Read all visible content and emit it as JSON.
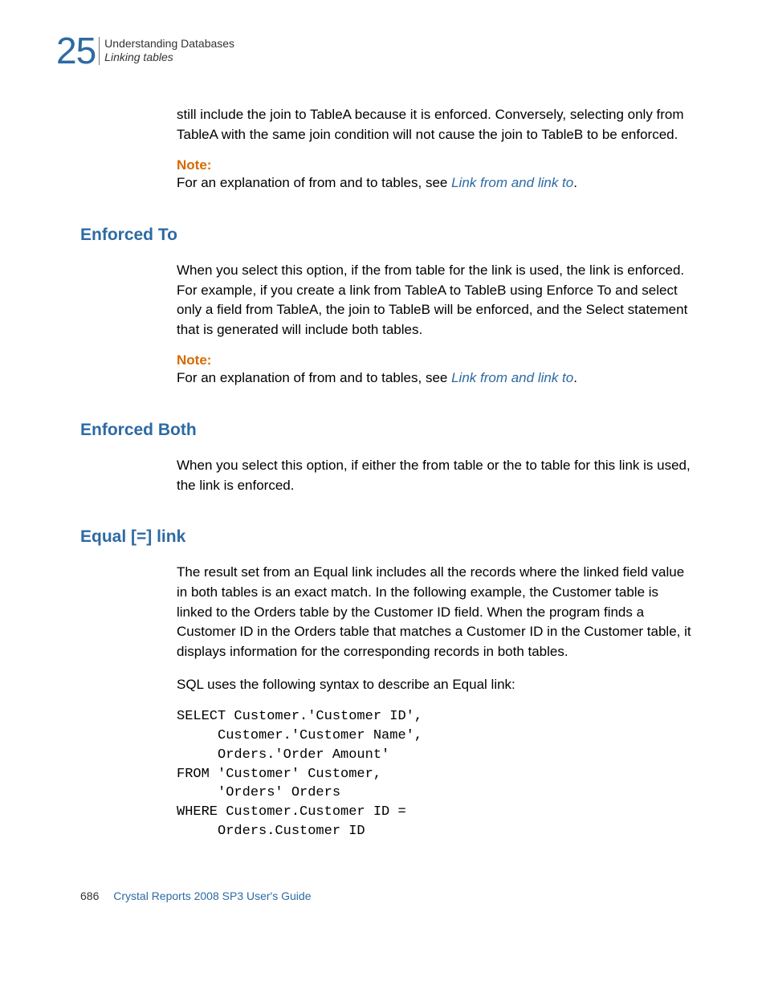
{
  "header": {
    "chapter_number": "25",
    "chapter_title": "Understanding Databases",
    "chapter_subtitle": "Linking tables"
  },
  "intro_paragraph": "still include the join to TableA because it is enforced. Conversely, selecting only from TableA with the same join condition will not cause the join to TableB to be enforced.",
  "note1": {
    "label": "Note:",
    "text": "For an explanation of from and to tables, see ",
    "link": "Link from and link to",
    "period": "."
  },
  "section1": {
    "heading": "Enforced To",
    "paragraph": "When you select this option, if the from table for the link is used, the link is enforced. For example, if you create a link from TableA to TableB using Enforce To and select only a field from TableA, the join to TableB will be enforced, and the Select statement that is generated will include both tables.",
    "note": {
      "label": "Note:",
      "text": "For an explanation of from and to tables, see ",
      "link": "Link from and link to",
      "period": "."
    }
  },
  "section2": {
    "heading": "Enforced Both",
    "paragraph": "When you select this option, if either the from table or the to table for this link is used, the link is enforced."
  },
  "section3": {
    "heading": "Equal [=] link",
    "paragraph1": "The result set from an Equal link includes all the records where the linked field value in both tables is an exact match. In the following example, the Customer table is linked to the Orders table by the Customer ID field. When the program finds a Customer ID in the Orders table that matches a Customer ID in the Customer table, it displays information for the corresponding records in both tables.",
    "paragraph2": "SQL uses the following syntax to describe an Equal link:",
    "code": "SELECT Customer.'Customer ID',\n     Customer.'Customer Name',\n     Orders.'Order Amount'\nFROM 'Customer' Customer,\n     'Orders' Orders\nWHERE Customer.Customer ID =\n     Orders.Customer ID"
  },
  "footer": {
    "page_number": "686",
    "guide_title": "Crystal Reports 2008 SP3 User's Guide"
  }
}
